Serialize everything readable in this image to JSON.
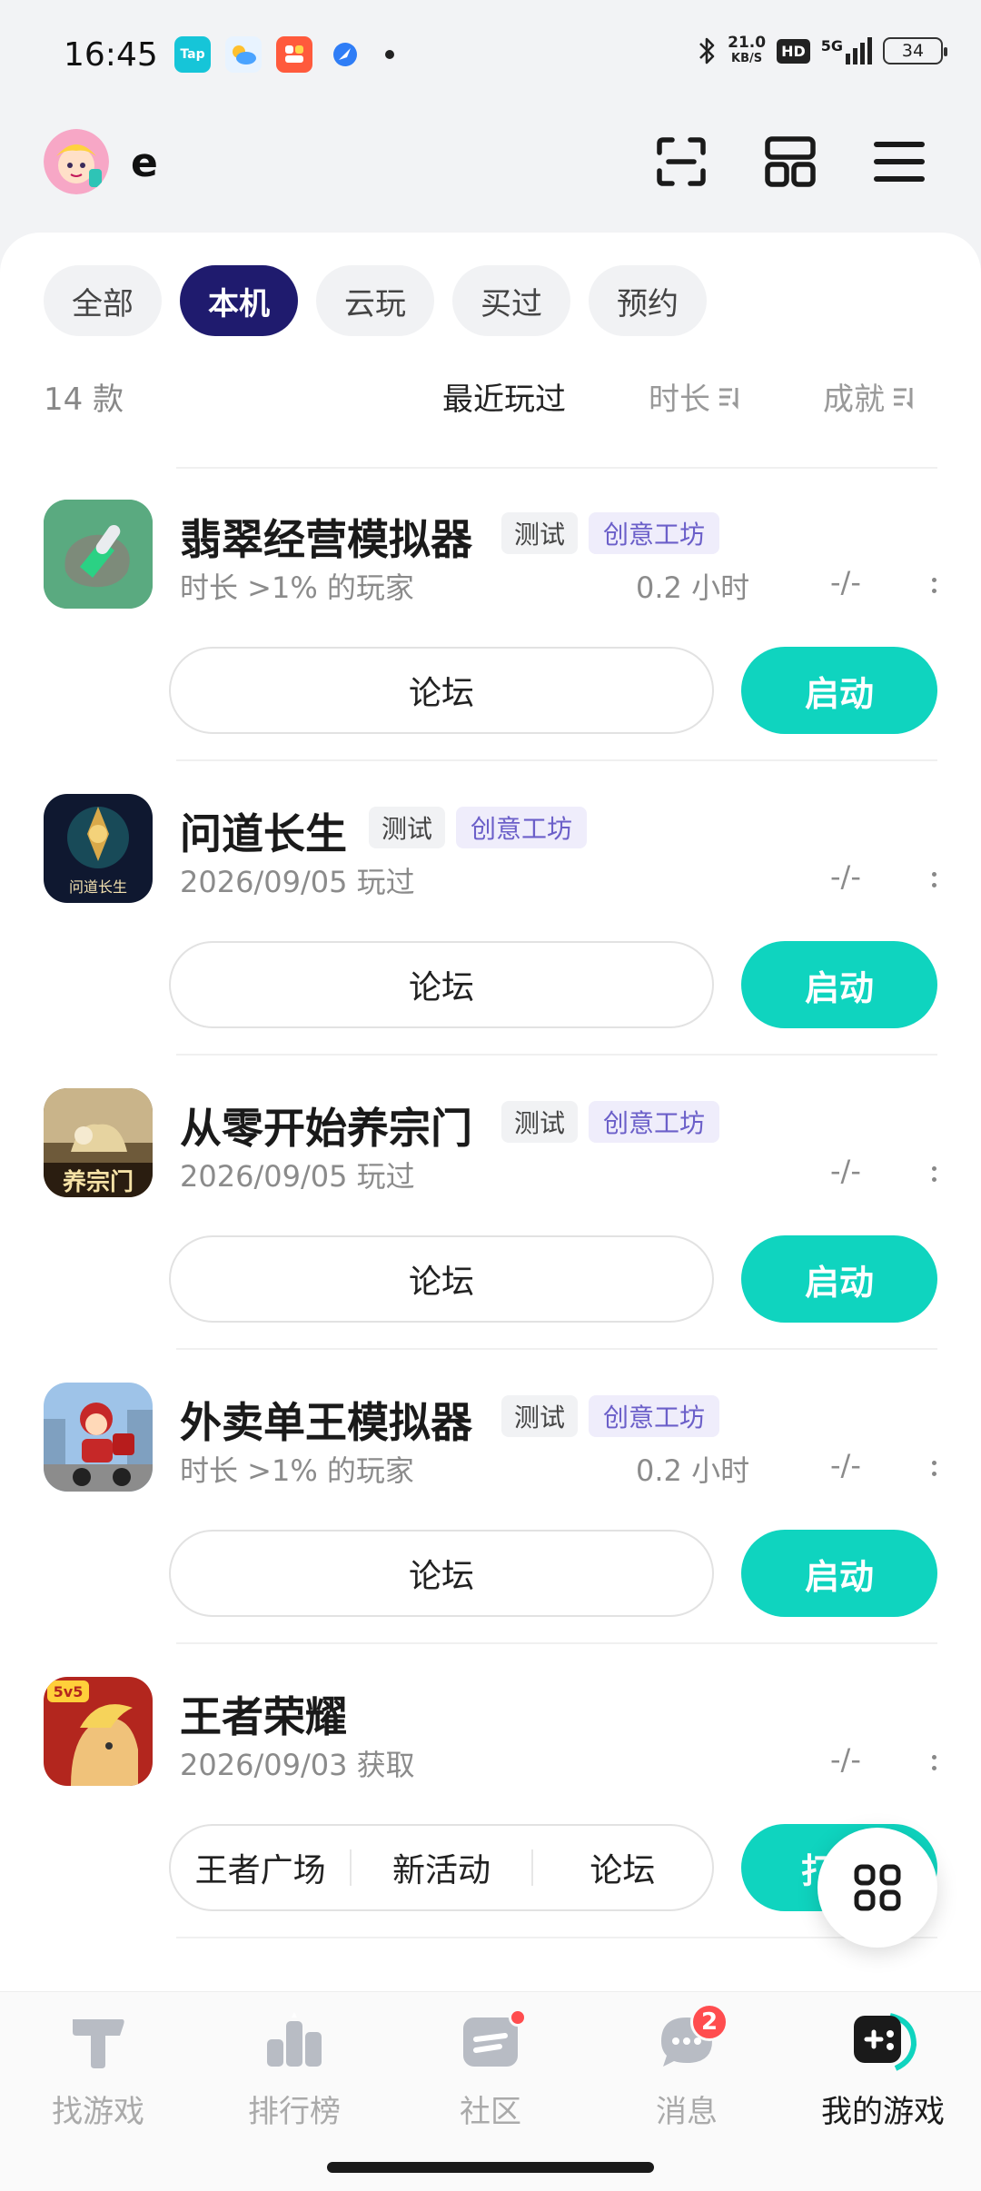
{
  "status_bar": {
    "time": "16:45",
    "net_speed_value": "21.0",
    "net_speed_unit": "KB/S",
    "hd_label": "HD",
    "signal_label": "5G",
    "battery": "34",
    "notification_apps": [
      "Tap"
    ],
    "icons": [
      "bluetooth-icon",
      "signal-icon",
      "battery-icon"
    ]
  },
  "header": {
    "username": "e",
    "icons": [
      "scan-icon",
      "grid-layout-icon",
      "menu-icon"
    ]
  },
  "filter_tabs": [
    {
      "label": "全部",
      "active": false
    },
    {
      "label": "本机",
      "active": true
    },
    {
      "label": "云玩",
      "active": false
    },
    {
      "label": "买过",
      "active": false
    },
    {
      "label": "预约",
      "active": false
    }
  ],
  "sort_bar": {
    "count": "14 款",
    "options": [
      "最近玩过",
      "时长",
      "成就"
    ]
  },
  "games": [
    {
      "name": "翡翠经营模拟器",
      "tags": [
        "测试",
        "创意工坊"
      ],
      "subtitle": "时长 >1% 的玩家",
      "hours": "0.2 小时",
      "achievement": "-/-",
      "buttons": [
        "论坛"
      ],
      "action": "启动"
    },
    {
      "name": "问道长生",
      "tags": [
        "测试",
        "创意工坊"
      ],
      "subtitle": "2026/09/05 玩过",
      "hours": "",
      "achievement": "-/-",
      "buttons": [
        "论坛"
      ],
      "action": "启动"
    },
    {
      "name": "从零开始养宗门",
      "tags": [
        "测试",
        "创意工坊"
      ],
      "subtitle": "2026/09/05 玩过",
      "hours": "",
      "achievement": "-/-",
      "buttons": [
        "论坛"
      ],
      "action": "启动"
    },
    {
      "name": "外卖单王模拟器",
      "tags": [
        "测试",
        "创意工坊"
      ],
      "subtitle": "时长 >1% 的玩家",
      "hours": "0.2 小时",
      "achievement": "-/-",
      "buttons": [
        "论坛"
      ],
      "action": "启动"
    },
    {
      "name": "王者荣耀",
      "tags": [],
      "subtitle": "2026/09/03 获取",
      "hours": "",
      "achievement": "-/-",
      "buttons": [
        "王者广场",
        "新活动",
        "论坛"
      ],
      "action": "打"
    }
  ],
  "icon_text": {
    "game2_icon_text": "问道长生",
    "game3_icon_text": "养宗门",
    "game5_icon_text": "5v5"
  },
  "bottom_nav": [
    {
      "label": "找游戏",
      "icon": "find-games-icon",
      "active": false
    },
    {
      "label": "排行榜",
      "icon": "ranking-icon",
      "active": false
    },
    {
      "label": "社区",
      "icon": "community-icon",
      "active": false,
      "dot": true
    },
    {
      "label": "消息",
      "icon": "messages-icon",
      "active": false,
      "badge": "2"
    },
    {
      "label": "我的游戏",
      "icon": "my-games-icon",
      "active": true
    }
  ],
  "colors": {
    "accent": "#0fd4bf",
    "active_tab": "#1f1b6e",
    "workshop_tag": "#6b5fc9",
    "badge": "#ff4d4f"
  }
}
